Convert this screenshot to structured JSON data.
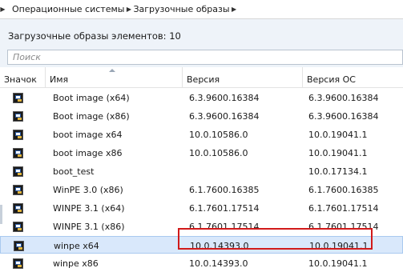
{
  "breadcrumb": {
    "items": [
      "Операционные системы",
      "Загрузочные образы"
    ],
    "separator_glyph": "▶"
  },
  "header": {
    "count_text": "Загрузочные образы элементов: 10"
  },
  "search": {
    "placeholder": "Поиск"
  },
  "table": {
    "columns": [
      "Значок",
      "Имя",
      "Версия",
      "Версия ОС"
    ],
    "sorted_column": "Имя",
    "rows": [
      {
        "icon": "boot-image-icon",
        "name": "Boot image (x64)",
        "version": "6.3.9600.16384",
        "os_version": "6.3.9600.16384"
      },
      {
        "icon": "boot-image-icon",
        "name": "Boot image (x86)",
        "version": "6.3.9600.16384",
        "os_version": "6.3.9600.16384"
      },
      {
        "icon": "boot-image-icon",
        "name": "boot image x64",
        "version": "10.0.10586.0",
        "os_version": "10.0.19041.1"
      },
      {
        "icon": "boot-image-icon",
        "name": "boot image x86",
        "version": "10.0.10586.0",
        "os_version": "10.0.19041.1"
      },
      {
        "icon": "boot-image-icon",
        "name": "boot_test",
        "version": "",
        "os_version": "10.0.17134.1"
      },
      {
        "icon": "boot-image-icon",
        "name": "WinPE 3.0 (x86)",
        "version": "6.1.7600.16385",
        "os_version": "6.1.7600.16385"
      },
      {
        "icon": "boot-image-icon",
        "name": "WINPE 3.1 (x64)",
        "version": "6.1.7601.17514",
        "os_version": "6.1.7601.17514"
      },
      {
        "icon": "boot-image-icon",
        "name": "WINPE 3.1 (x86)",
        "version": "6.1.7601.17514",
        "os_version": "6.1.7601.17514"
      },
      {
        "icon": "boot-image-icon",
        "name": "winpe x64",
        "version": "10.0.14393.0",
        "os_version": "10.0.19041.1",
        "selected": true
      },
      {
        "icon": "boot-image-icon",
        "name": "winpe x86",
        "version": "10.0.14393.0",
        "os_version": "10.0.19041.1"
      }
    ]
  },
  "colors": {
    "selection_bg": "#d9e8fb",
    "highlight_border": "#d11a1a",
    "header_bg": "#eef3f9"
  }
}
